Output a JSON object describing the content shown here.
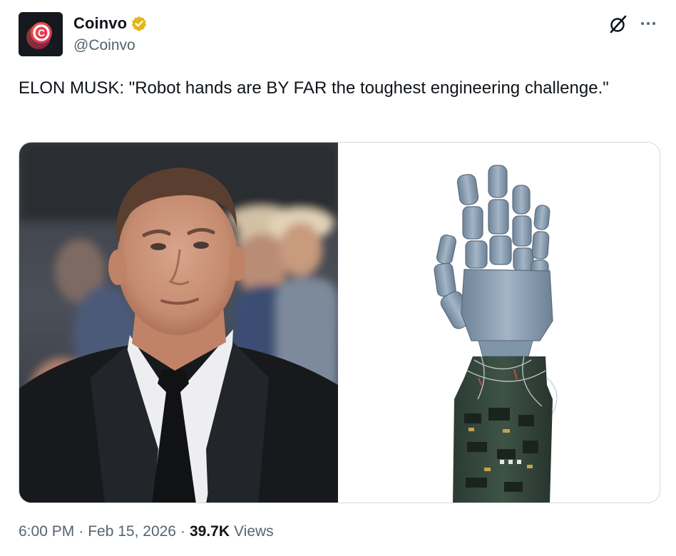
{
  "author": {
    "display_name": "Coinvo",
    "handle": "@Coinvo",
    "avatar_icon": "coinvo-logo-icon",
    "verified_icon": "verified-badge-icon",
    "verified_color": "#e2b719"
  },
  "actions": {
    "grok_icon": "grok-icon",
    "more_icon": "more-options-icon"
  },
  "tweet": {
    "text": "ELON MUSK: \"Robot hands are BY FAR the toughest engineering challenge.\""
  },
  "media": {
    "images": [
      {
        "name": "photo-elon-musk"
      },
      {
        "name": "photo-robot-hand"
      }
    ]
  },
  "meta": {
    "time": "6:00 PM",
    "separator": "·",
    "date": "Feb 15, 2026",
    "views_count": "39.7K",
    "views_label": "Views"
  },
  "colors": {
    "text_primary": "#0f1419",
    "text_secondary": "#536471",
    "border": "#cfd9de"
  }
}
